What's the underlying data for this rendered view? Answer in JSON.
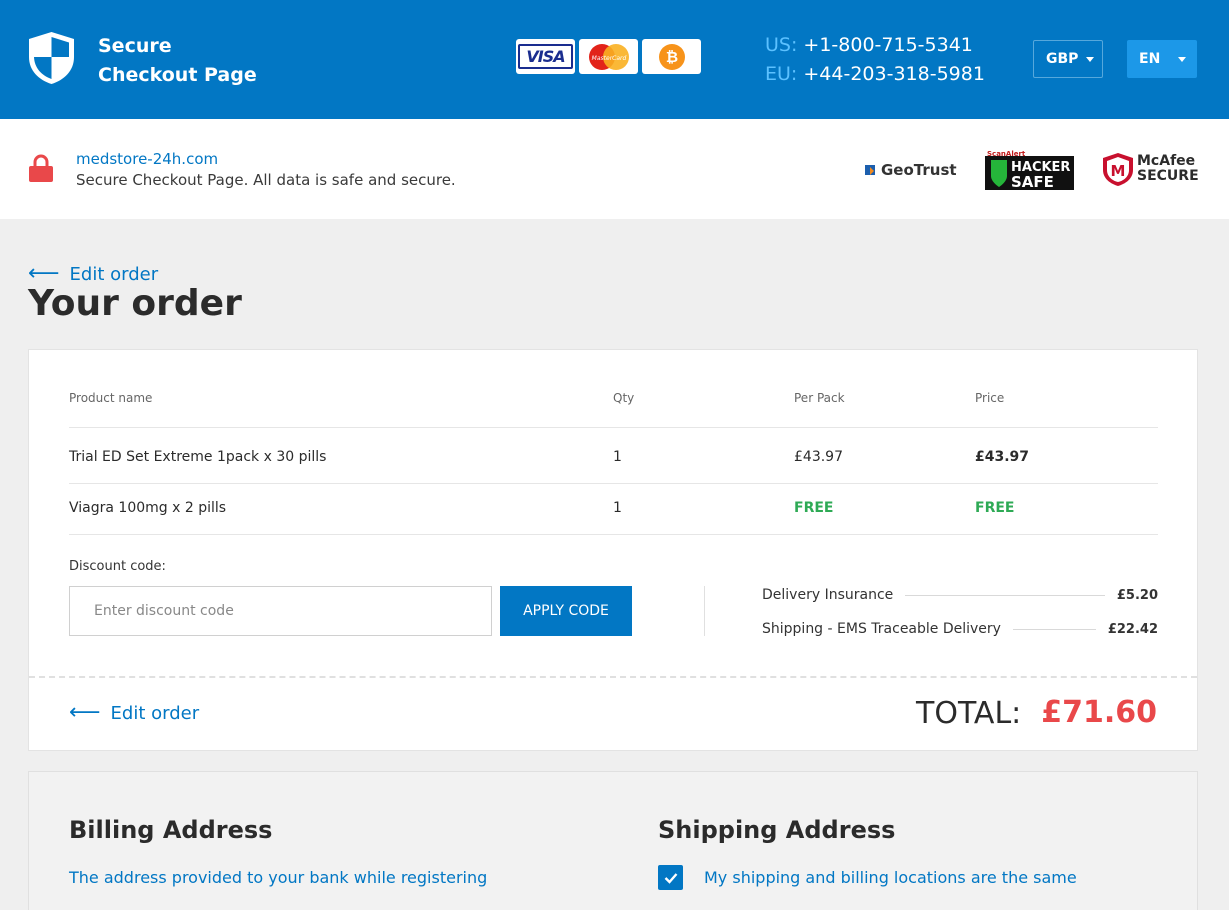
{
  "header": {
    "brand_line1": "Secure",
    "brand_line2": "Checkout Page",
    "cards": [
      {
        "name": "visa",
        "label": "VISA"
      },
      {
        "name": "mastercard",
        "label": "MasterCard"
      },
      {
        "name": "bitcoin",
        "label": "₿"
      }
    ],
    "phone_us_prefix": "US:",
    "phone_us": "+1-800-715-5341",
    "phone_eu_prefix": "EU:",
    "phone_eu": "+44-203-318-5981",
    "currency": "GBP",
    "language": "EN",
    "colors": {
      "bar": "#0277c4",
      "accent": "#1c98e8"
    }
  },
  "secure_bar": {
    "site": "medstore-24h.com",
    "message": "Secure Checkout Page. All data is safe and secure.",
    "badges": {
      "geotrust": "GeoTrust",
      "hacker_top": "ScanAlert",
      "hacker_l1": "HACKER",
      "hacker_l2": "SAFE",
      "mcafee_l1": "McAfee",
      "mcafee_l2": "SECURE"
    }
  },
  "page": {
    "edit_order": "Edit order",
    "title": "Your order"
  },
  "order": {
    "columns": [
      "Product name",
      "Qty",
      "Per Pack",
      "Price"
    ],
    "rows": [
      {
        "product": "Trial ED Set Extreme 1pack x 30 pills",
        "qty": "1",
        "per_pack": "£43.97",
        "price": "£43.97"
      },
      {
        "product": "Viagra 100mg x 2 pills",
        "qty": "1",
        "per_pack": "FREE",
        "price": "FREE"
      }
    ],
    "discount_label": "Discount code:",
    "discount_placeholder": "Enter discount code",
    "apply_label": "APPLY CODE",
    "fees": [
      {
        "label": "Delivery Insurance",
        "amount": "£5.20"
      },
      {
        "label": "Shipping - EMS Traceable Delivery",
        "amount": "£22.42"
      }
    ],
    "edit_order": "Edit order",
    "total_label": "TOTAL:",
    "total_value": "£71.60",
    "total_color": "#e9484a",
    "free_color": "#2eaa55"
  },
  "address": {
    "billing_title": "Billing Address",
    "billing_note": "The address provided to your bank while registering",
    "shipping_title": "Shipping Address",
    "same_label": "My shipping and billing locations are the same",
    "same_checked": true
  }
}
